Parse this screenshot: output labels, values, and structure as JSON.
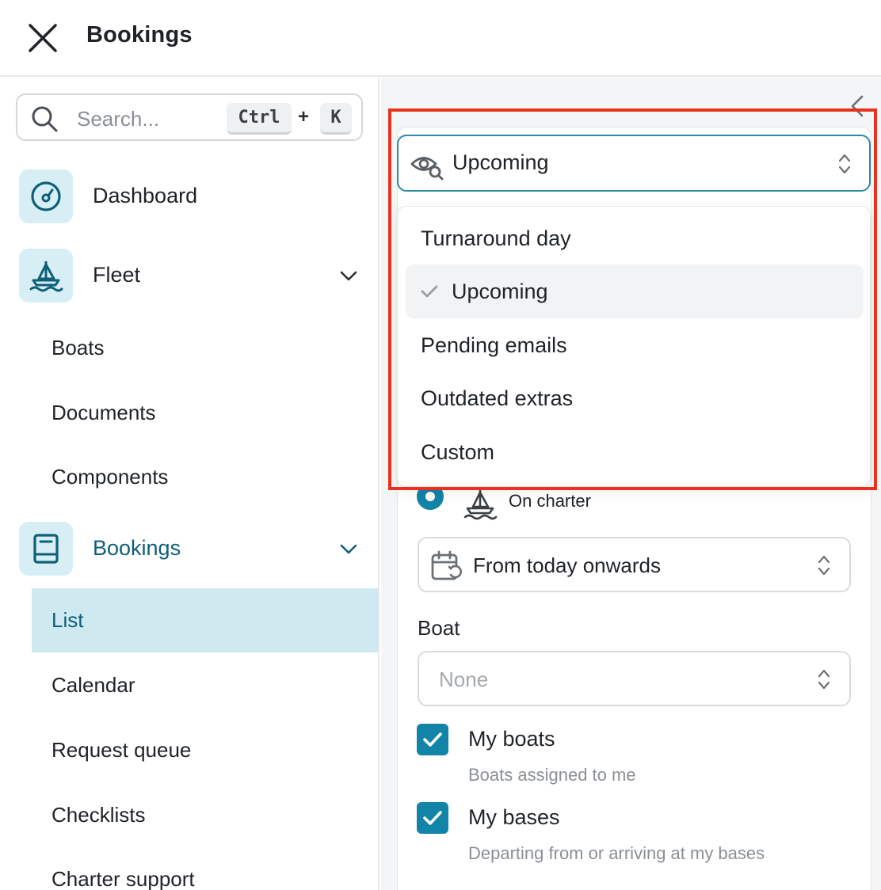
{
  "header": {
    "title": "Bookings"
  },
  "search": {
    "placeholder": "Search...",
    "shortcut_ctrl": "Ctrl",
    "shortcut_plus": "+",
    "shortcut_key": "K"
  },
  "sidebar": {
    "dashboard": "Dashboard",
    "fleet": "Fleet",
    "fleet_items": [
      "Boats",
      "Documents",
      "Components"
    ],
    "bookings": "Bookings",
    "bookings_items": [
      "List",
      "Calendar",
      "Request queue",
      "Checklists",
      "Charter support"
    ],
    "active_item": "List"
  },
  "filters": {
    "view_select": {
      "value": "Upcoming"
    },
    "view_options": [
      "Turnaround day",
      "Upcoming",
      "Pending emails",
      "Outdated extras",
      "Custom"
    ],
    "selected_option": "Upcoming",
    "status_option": "On charter",
    "date_range": "From today onwards",
    "boat_label": "Boat",
    "boat_placeholder": "None",
    "my_boats": {
      "label": "My boats",
      "description": "Boats assigned to me",
      "checked": true
    },
    "my_bases": {
      "label": "My bases",
      "description": "Departing from or arriving at my bases",
      "checked": true
    }
  },
  "colors": {
    "accent": "#1184a7",
    "active_bg": "#cfe9f1",
    "highlight": "#e8321e"
  }
}
